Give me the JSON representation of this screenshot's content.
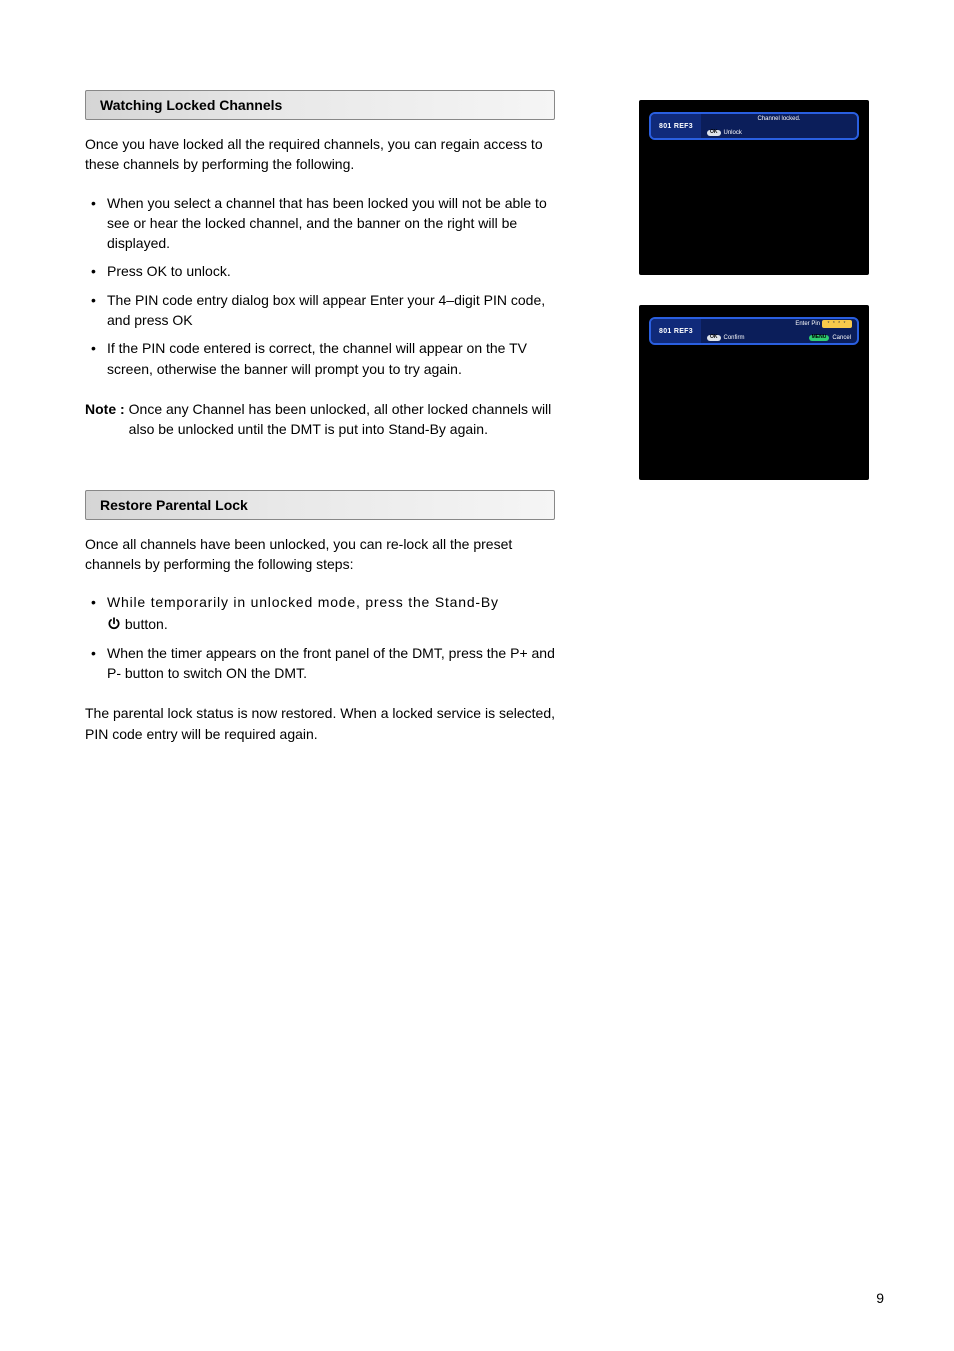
{
  "section1": {
    "header": "Watching Locked Channels",
    "intro": "Once you have locked all the required channels, you can regain access to these channels by performing the following.",
    "bullets": [
      "When you select a channel that has been locked you will not be able to see or hear the locked channel, and the banner on the right will be displayed.",
      "Press OK to unlock.",
      "The PIN code entry dialog box will appear Enter your 4–digit PIN code, and press OK",
      "If the PIN code entered is correct, the channel will appear on the TV screen, otherwise the banner will prompt you to try again."
    ],
    "note_label": "Note :",
    "note_text": "Once any Channel has been unlocked, all other locked channels will also be unlocked until the DMT is put into Stand-By again."
  },
  "section2": {
    "header": "Restore Parental Lock",
    "intro": "Once all channels have been unlocked, you can re-lock all the preset channels by performing the following steps:",
    "bullet1_a": "While temporarily in unlocked mode, press the Stand-By",
    "bullet1_b": "button.",
    "bullet2": "When the timer appears on the front panel of the DMT, press the P+ and P- button to switch ON the DMT.",
    "outro": "The parental lock status is now restored. When a locked service is selected, PIN code entry will be required again."
  },
  "tv1": {
    "channel": "801 REF3",
    "title": "Channel locked.",
    "ok": "OK",
    "unlock": "Unlock"
  },
  "tv2": {
    "channel": "801 REF3",
    "enter_pin": "Enter Pin",
    "pin_mask": "* * * *",
    "ok": "OK",
    "confirm": "Confirm",
    "menu": "MENU",
    "cancel": "Cancel"
  },
  "page_number": "9"
}
